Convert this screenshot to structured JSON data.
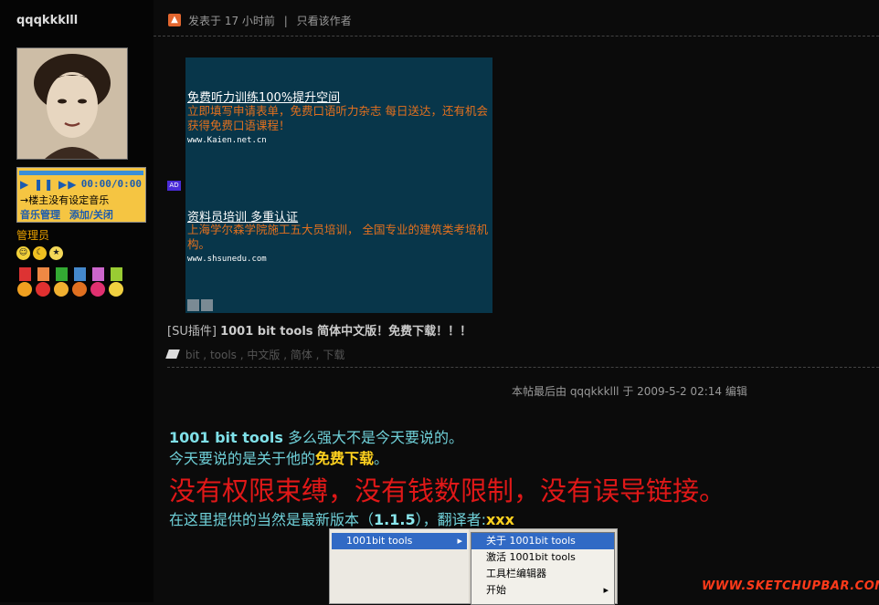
{
  "sidebar": {
    "username": "qqqkkklll",
    "role": "管理员",
    "music_player": {
      "controls": "▶ ❚❚ ▶▶",
      "time": "00:00/0:00",
      "note": "→楼主没有设定音乐",
      "manage_label": "音乐管理",
      "toggle_label": "添加/关闭"
    }
  },
  "post_header": {
    "posted_label": "发表于 17 小时前",
    "separator": "|",
    "author_only_label": "只看该作者"
  },
  "ad": {
    "badge": "AD",
    "items": [
      {
        "title": "免费听力训练100%提升空间",
        "desc": "立即填写申请表单，免费口语听力杂志  每日送达，还有机会获得免费口语课程！",
        "url": "www.Kaien.net.cn"
      },
      {
        "title": "资料员培训  多重认证",
        "desc": "上海学尔森学院施工五大员培训，  全国专业的建筑类考培机构。",
        "url": "www.shsunedu.com"
      }
    ]
  },
  "thread": {
    "category": "[SU插件]",
    "title": "1001 bit tools 简体中文版！免费下载！！！",
    "tags": [
      "bit",
      "tools",
      "中文版",
      "简体",
      "下载"
    ]
  },
  "edit_note": "本帖最后由 qqqkkklll 于 2009-5-2 02:14 编辑",
  "content": {
    "line1_bold": "1001 bit tools",
    "line1_rest": " 多么强大不是今天要说的。",
    "line2_pre": "今天要说的是关于他的",
    "line2_bold": "免费下载",
    "line2_post": "。",
    "line3": "没有权限束缚，没有钱数限制，没有误导链接。",
    "line4_pre": "在这里提供的当然是最新版本（",
    "line4_version": "1.1.5",
    "line4_mid": "），翻译者:",
    "line4_translator": "xxx"
  },
  "menu_screenshot": {
    "main_item": "1001bit tools",
    "submenu": [
      "关于 1001bit tools",
      "激活 1001bit tools",
      "工具栏编辑器",
      "开始"
    ]
  },
  "watermark": "WWW.SKETCHUPBAR.COM"
}
